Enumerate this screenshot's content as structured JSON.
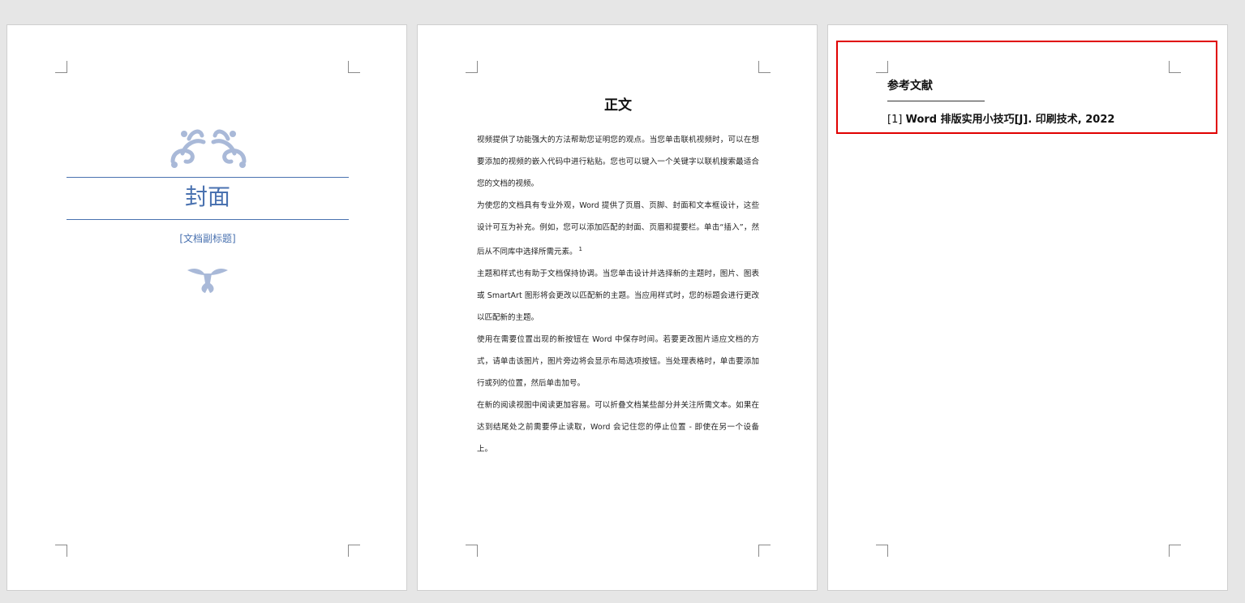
{
  "cover": {
    "title": "封面",
    "subtitle": "[文档副标题]"
  },
  "body": {
    "heading": "正文",
    "paragraphs": [
      "视频提供了功能强大的方法帮助您证明您的观点。当您单击联机视频时，可以在想要添加的视频的嵌入代码中进行粘贴。您也可以键入一个关键字以联机搜索最适合您的文档的视频。",
      "为使您的文档具有专业外观，Word 提供了页眉、页脚、封面和文本框设计，这些设计可互为补充。例如，您可以添加匹配的封面、页眉和提要栏。单击“插入”，然后从不同库中选择所需元素。",
      "主题和样式也有助于文档保持协调。当您单击设计并选择新的主题时，图片、图表或 SmartArt 图形将会更改以匹配新的主题。当应用样式时，您的标题会进行更改以匹配新的主题。",
      "使用在需要位置出现的新按钮在 Word 中保存时间。若要更改图片适应文档的方式，请单击该图片，图片旁边将会显示布局选项按钮。当处理表格时，单击要添加行或列的位置，然后单击加号。",
      "在新的阅读视图中阅读更加容易。可以折叠文档某些部分并关注所需文本。如果在达到结尾处之前需要停止读取，Word 会记住您的停止位置 - 即使在另一个设备上。"
    ],
    "footnote_marker": "1"
  },
  "references": {
    "heading": "参考文献",
    "entry_number": "[1]",
    "entry_text": "Word 排版实用小技巧[J]. 印刷技术, 2022"
  },
  "colors": {
    "accent": "#4a72b0",
    "highlight": "#e00000",
    "canvas": "#e6e6e6"
  }
}
